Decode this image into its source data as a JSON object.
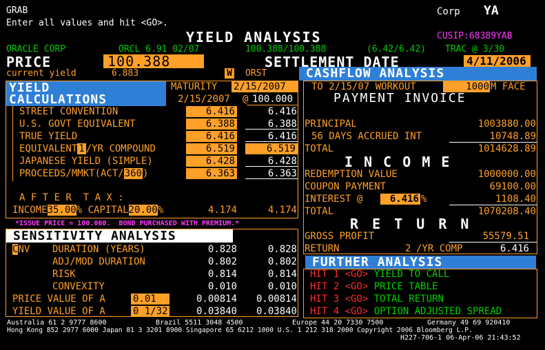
{
  "header": {
    "grab": "GRAB",
    "instructions": "Enter all values and hit <GO>.",
    "corp_label": "Corp",
    "function": "YA",
    "title": "YIELD ANALYSIS",
    "cusip": "CUSIP:68389YAB"
  },
  "security": {
    "issuer": "ORACLE CORP",
    "ticker": "ORCL 6.91 02/07",
    "price_quote": "100.388/100.388",
    "yield_quote": "(6.42/6.42)",
    "trac": "TRAC @ 3/30"
  },
  "price": {
    "label": "PRICE",
    "value": "100.388",
    "settlement_label": "SETTLEMENT DATE",
    "settlement_value": "4/11/2006",
    "current_yield_label": "current yield",
    "current_yield_value": "6.883",
    "w_label": "W",
    "orst_label": "ORST"
  },
  "yield_calc": {
    "header1": "YIELD",
    "header2": "CALCULATIONS",
    "maturity_label": "MATURITY",
    "maturity_value": "2/15/2007",
    "date2": "2/15/2007",
    "at_label": "@",
    "at_value": "100.000",
    "rows": [
      {
        "label": "STREET CONVENTION",
        "v1": "6.416",
        "v2": "6.416"
      },
      {
        "label": "U.S. GOVT EQUIVALENT",
        "v1": "6.388",
        "v2": "6.388"
      },
      {
        "label": "TRUE YIELD",
        "v1": "6.416",
        "v2": "6.416"
      },
      {
        "label_pre": "EQUIVALENT",
        "label_box": "1",
        "label_post": "/YR COMPOUND",
        "v1": "6.519",
        "v2": "6.519"
      },
      {
        "label": "JAPANESE YIELD (SIMPLE)",
        "v1": "6.428",
        "v2": "6.428"
      },
      {
        "label_pre": "PROCEEDS/MMKT(ACT/",
        "label_box": "360",
        "label_post": ")",
        "v1": "6.363",
        "v2": "6.363"
      }
    ],
    "after_tax_label": "A F T E R  T A X :",
    "income_label": "INCOME",
    "income_value": "35.00",
    "capital_label": "% CAPITAL",
    "capital_value": "20.00",
    "pct": "%",
    "after_tax_v1": "4.174",
    "after_tax_v2": "4.174",
    "note": "*ISSUE PRICE = 100.000.  BOND PURCHASED WITH PREMIUM.*"
  },
  "sensitivity": {
    "header": "SENSITIVITY ANALYSIS",
    "cnv_c": "C",
    "cnv_rest": "NV",
    "rows": [
      {
        "label": "DURATION (YEARS)",
        "v1": "0.828",
        "v2": "0.828"
      },
      {
        "label": "ADJ/MOD DURATION",
        "v1": "0.802",
        "v2": "0.802"
      },
      {
        "label": "RISK",
        "v1": "0.814",
        "v2": "0.814"
      },
      {
        "label": "CONVEXITY",
        "v1": "0.010",
        "v2": "0.010"
      }
    ],
    "pv_label": "PRICE VALUE OF A",
    "pv_box": "0.01",
    "pv_v1": "0.00814",
    "pv_v2": "0.00814",
    "yv_label": "YIELD VALUE OF A",
    "yv_box": "0 1/32",
    "yv_v1": "0.03840",
    "yv_v2": "0.03840"
  },
  "cashflow": {
    "header": "CASHFLOW ANALYSIS",
    "workout": "TO 2/15/07 WORKOUT",
    "face_value": "1000",
    "face_label": "M FACE",
    "payment_invoice": "PAYMENT INVOICE",
    "principal_label": "PRINCIPAL",
    "principal_value": "1003880.00",
    "accrued_label": "56 DAYS ACCRUED INT",
    "accrued_value": "10748.89",
    "total_label": "TOTAL",
    "total_value": "1014628.89",
    "income_header": "I N C O M E",
    "redemption_label": "REDEMPTION VALUE",
    "redemption_value": "1000000.00",
    "coupon_label": "COUPON PAYMENT",
    "coupon_value": "69100.00",
    "interest_label": "INTEREST @",
    "interest_rate": "6.416",
    "interest_pct": "%",
    "interest_value": "1108.40",
    "income_total_label": "TOTAL",
    "income_total_value": "1070208.40",
    "return_header": "R E T U R N",
    "gross_label": "GROSS PROFIT",
    "gross_value": "55579.51",
    "return_label": "RETURN",
    "return_freq": "2",
    "return_comp": "/YR COMP",
    "return_value": "6.416"
  },
  "further": {
    "header": "FURTHER ANALYSIS",
    "items": [
      {
        "hit": "HIT 1 <GO>",
        "label": "YIELD TO CALL"
      },
      {
        "hit": "HIT 2 <GO>",
        "label": "PRICE TABLE"
      },
      {
        "hit": "HIT 3 <GO>",
        "label": "TOTAL RETURN"
      },
      {
        "hit": "HIT 4 <GO>",
        "label": "OPTION ADJUSTED SPREAD"
      }
    ]
  },
  "footer": {
    "line1_a": "Australia 61 2 9777 8600",
    "line1_b": "Brazil 5511 3048 4500",
    "line1_c": "Europe 44 20 7330 7500",
    "line1_d": "Germany 49 69 920410",
    "line2": "Hong Kong 852 2977 6000 Japan 81 3 3201 8900 Singapore 65 6212 1000 U.S. 1 212 318 2000 Copyright 2006 Bloomberg L.P.",
    "line3": "H227-706-1 06-Apr-06 21:43:52"
  },
  "colors": {
    "background": "#000000",
    "amber": "#ffa028",
    "green": "#00d000",
    "blue_header": "#2f7fd6",
    "magenta": "#ff3aff",
    "red": "#ff2a2a"
  }
}
